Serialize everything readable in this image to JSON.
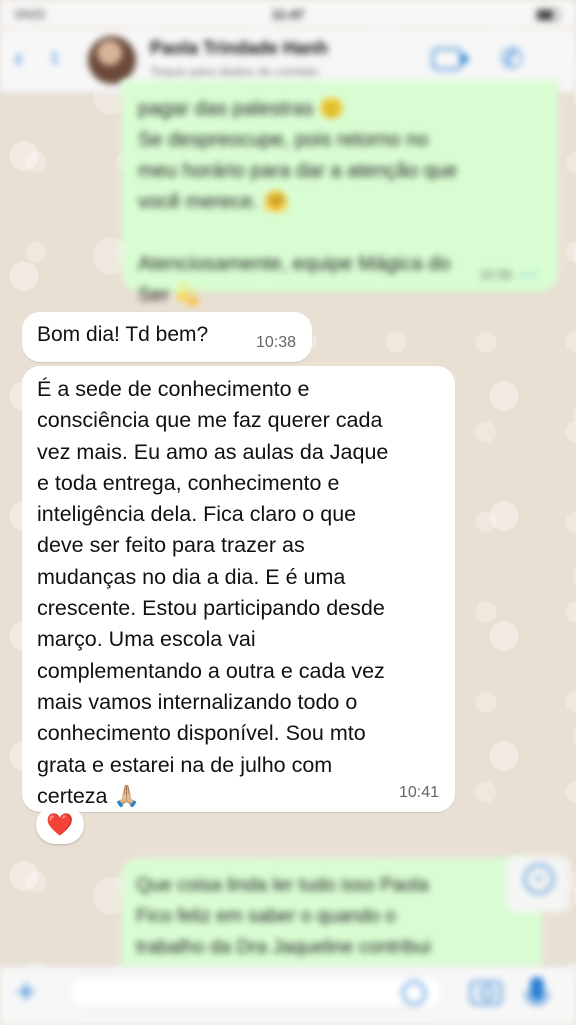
{
  "status_bar": {
    "carrier": "VIVO",
    "time": "11:47"
  },
  "header": {
    "back_count": "1",
    "contact_name": "Paola Trindade Hanh",
    "contact_subtitle": "Toque para dados do contato"
  },
  "messages": [
    {
      "direction": "outgoing",
      "text": "pagar das palestras 🙂\nSe despreocupe, pois retorno no\nmeu horário para dar a atenção que\nvocê merece. 🤗\n\nAtenciosamente, equipe Mágica do\nSer 💫",
      "time": "10:36",
      "status": "read"
    },
    {
      "direction": "incoming",
      "text": "Bom dia! Td bem?",
      "time": "10:38"
    },
    {
      "direction": "incoming",
      "text": "É a sede de conhecimento e\nconsciência que me faz querer cada\nvez mais. Eu amo as aulas da Jaque\ne toda entrega, conhecimento e\ninteligência dela. Fica claro o que\ndeve ser feito para trazer as\nmudanças no dia a dia. E é uma\ncrescente. Estou participando desde\nmarço. Uma escola vai\ncomplementando a outra e cada vez\nmais vamos internalizando todo o\nconhecimento disponível. Sou mto\ngrata e estarei na de julho com\ncerteza",
      "emoji": "🙏🏼",
      "time": "10:41",
      "reaction": "❤️"
    },
    {
      "direction": "outgoing",
      "text": "Que coisa linda ler tudo isso Paola\nFico feliz em saber o quando o\ntrabalho da Dra Jaqueline contribui"
    }
  ],
  "colors": {
    "accent": "#2a7fd4",
    "outgoing_bubble": "#d9fdd3",
    "incoming_bubble": "#ffffff",
    "reaction": "#e0202a"
  },
  "icons": {
    "back": "chevron-left-icon",
    "video": "video-camera-icon",
    "phone": "phone-icon",
    "plus": "plus-icon",
    "sticker": "sticker-icon",
    "camera": "camera-icon",
    "mic": "microphone-icon",
    "scroll": "chevron-down-icon"
  }
}
